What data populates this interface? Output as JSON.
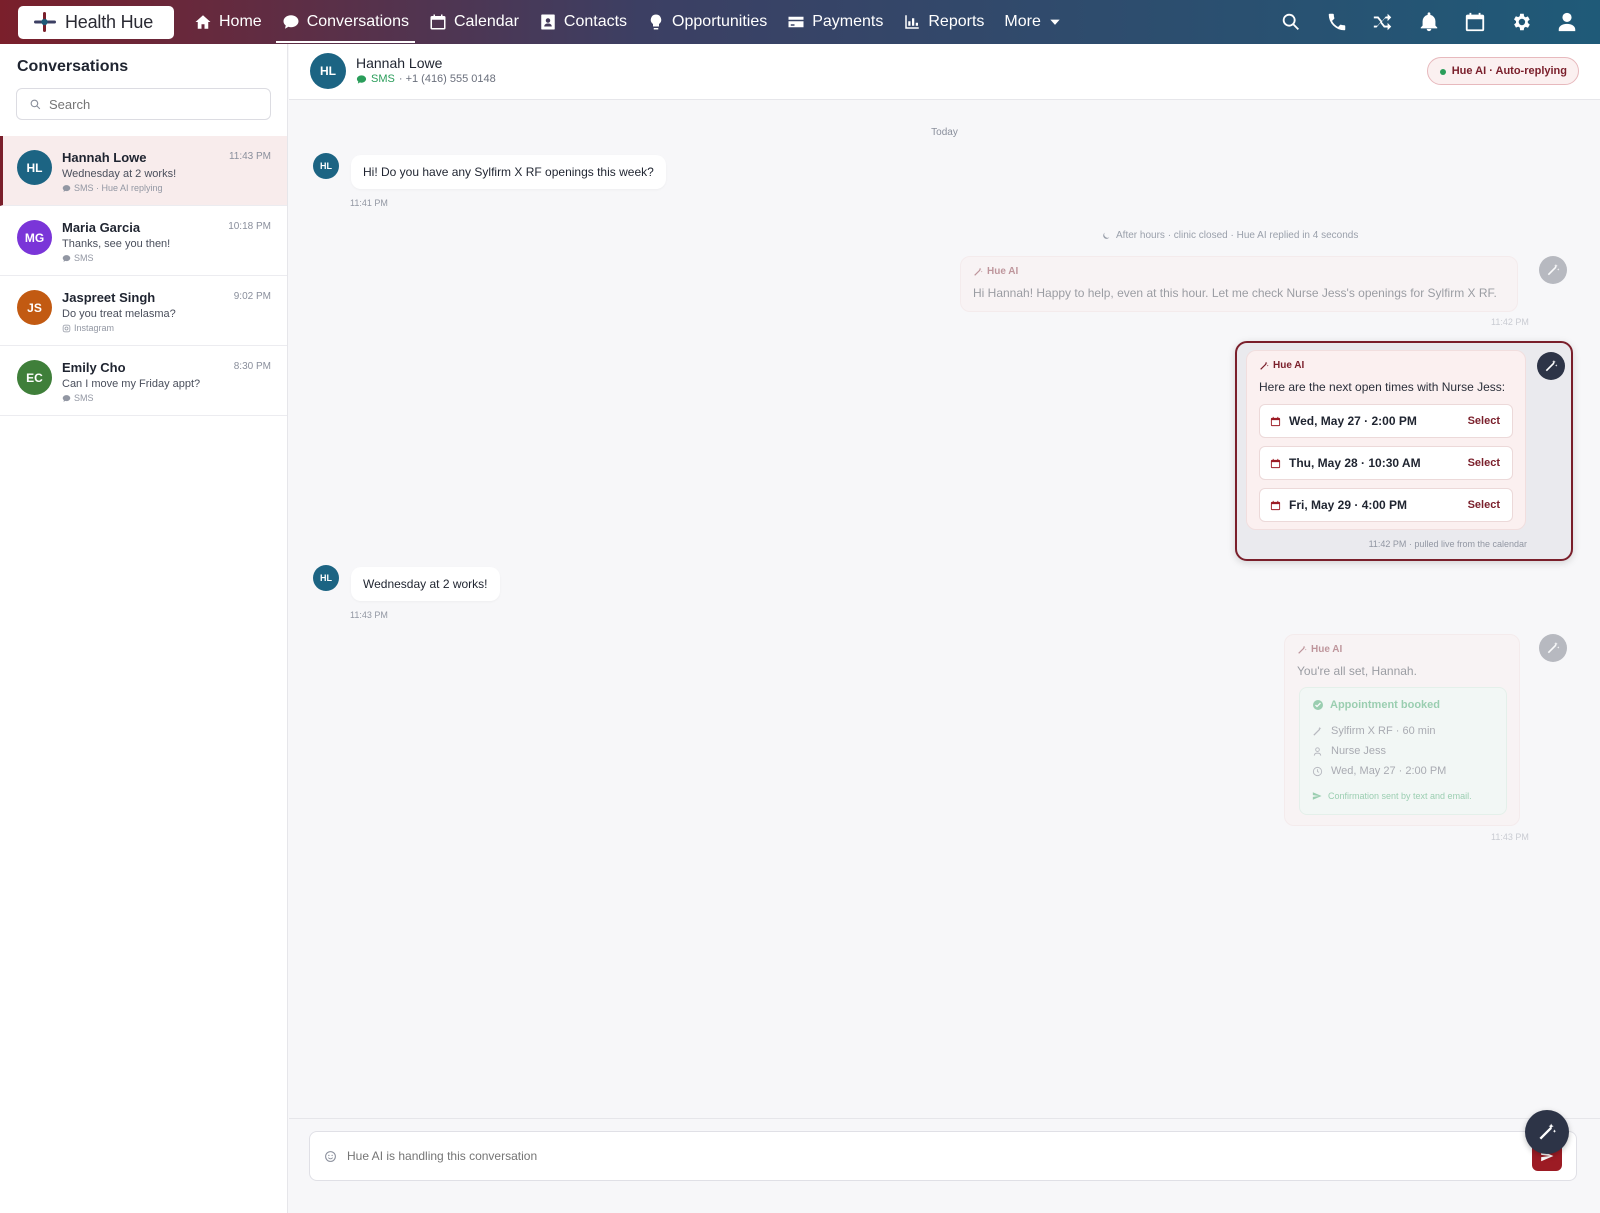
{
  "app": {
    "brand": "Health Hue"
  },
  "nav": {
    "items": [
      {
        "label": "Home",
        "icon": "home-icon"
      },
      {
        "label": "Conversations",
        "icon": "chat-icon"
      },
      {
        "label": "Calendar",
        "icon": "calendar-icon"
      },
      {
        "label": "Contacts",
        "icon": "contacts-icon"
      },
      {
        "label": "Opportunities",
        "icon": "lightbulb-icon"
      },
      {
        "label": "Payments",
        "icon": "credit-card-icon"
      },
      {
        "label": "Reports",
        "icon": "bar-chart-icon"
      },
      {
        "label": "More",
        "icon": "chevron-down-icon"
      }
    ],
    "active": "Conversations"
  },
  "sidebar": {
    "title": "Conversations",
    "search_placeholder": "Search",
    "conversations": [
      {
        "initials": "HL",
        "name": "Hannah Lowe",
        "time": "11:43 PM",
        "preview": "Wednesday at 2 works!",
        "channel": "SMS · Hue AI replying",
        "color": "#1c6483",
        "active": true
      },
      {
        "initials": "MG",
        "name": "Maria Garcia",
        "time": "10:18 PM",
        "preview": "Thanks, see you then!",
        "channel": "SMS",
        "color": "#7a35d8",
        "active": false
      },
      {
        "initials": "JS",
        "name": "Jaspreet Singh",
        "time": "9:02 PM",
        "preview": "Do you treat melasma?",
        "channel": "Instagram",
        "color": "#c25a12",
        "active": false
      },
      {
        "initials": "EC",
        "name": "Emily Cho",
        "time": "8:30 PM",
        "preview": "Can I move my Friday appt?",
        "channel": "SMS",
        "color": "#3f7f3a",
        "active": false
      }
    ]
  },
  "chat": {
    "contact": {
      "initials": "HL",
      "name": "Hannah Lowe",
      "channel": "SMS",
      "phone": "· +1 (416) 555 0148"
    },
    "ai_status": "Hue AI · Auto-replying",
    "day_label": "Today",
    "messages": {
      "m1": {
        "text": "Hi! Do you have any Sylfirm X RF openings this week?",
        "time": "11:41 PM"
      },
      "note": "After hours · clinic closed · Hue AI replied in 4 seconds",
      "m2": {
        "label": "Hue AI",
        "text": "Hi Hannah! Happy to help, even at this hour. Let me check Nurse Jess's openings for Sylfirm X RF.",
        "time": "11:42 PM"
      },
      "m3": {
        "label": "Hue AI",
        "text": "Here are the next open times with Nurse Jess:",
        "slots": [
          {
            "label": "Wed, May 27 · 2:00 PM",
            "action": "Select"
          },
          {
            "label": "Thu, May 28 · 10:30 AM",
            "action": "Select"
          },
          {
            "label": "Fri, May 29 · 4:00 PM",
            "action": "Select"
          }
        ],
        "time": "11:42 PM · pulled live from the calendar"
      },
      "m4": {
        "text": "Wednesday at 2 works!",
        "time": "11:43 PM"
      },
      "m5": {
        "label": "Hue AI",
        "text": "You're all set, Hannah.",
        "booking": {
          "title": "Appointment booked",
          "service": "Sylfirm X RF · 60 min",
          "provider": "Nurse Jess",
          "when": "Wed, May 27 · 2:00 PM",
          "confirmation": "Confirmation sent by text and email."
        },
        "time": "11:43 PM"
      }
    },
    "composer_placeholder": "Hue AI is handling this conversation"
  },
  "colors": {
    "brand": "#7a1f2b",
    "accent_green": "#2a9d5a",
    "contact_blue": "#1c6483"
  }
}
